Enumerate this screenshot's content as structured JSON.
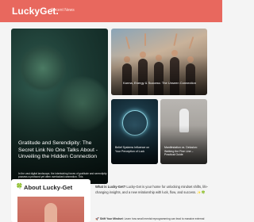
{
  "header": {
    "logo": "LuckyGet.",
    "nav_link": "Recent News"
  },
  "featured": {
    "main": {
      "title": "Gratitude and Serendipity: The Secret Link No One Talks About - Unveiling the Hidden Connection",
      "excerpt": "In the vast digital landscape, the intertwining forces of gratitude and serendipity possess a profound yet often overlooked connection. This"
    },
    "top_right": {
      "title": "Karma, Energy & Success: The Unseen Connection"
    },
    "bottom_left": {
      "title": "Belief Systems Influence on Your Perception of Luck"
    },
    "bottom_right": {
      "title": "Manifestation vs. Delusion: Walking the Fine Line – Practical Guide"
    }
  },
  "about": {
    "heading": "About Lucky-Get",
    "icon": "four-leaf-clover-icon",
    "intro_bold": "What is Lucky-Get?",
    "intro_text": " Lucky-Get is your home for unlocking mindset shifts, life-changing insights, and a new relationship with luck, flow, and success.",
    "intro_emoji": "✨🍀",
    "shift_label": "Shift Your Mindset",
    "shift_text": ": Learn how small mental reprogramming can lead to massive external"
  },
  "colors": {
    "header_bg": "#e8685e",
    "page_bg": "#f4f4f4",
    "accent_image": "#d27a6c"
  }
}
